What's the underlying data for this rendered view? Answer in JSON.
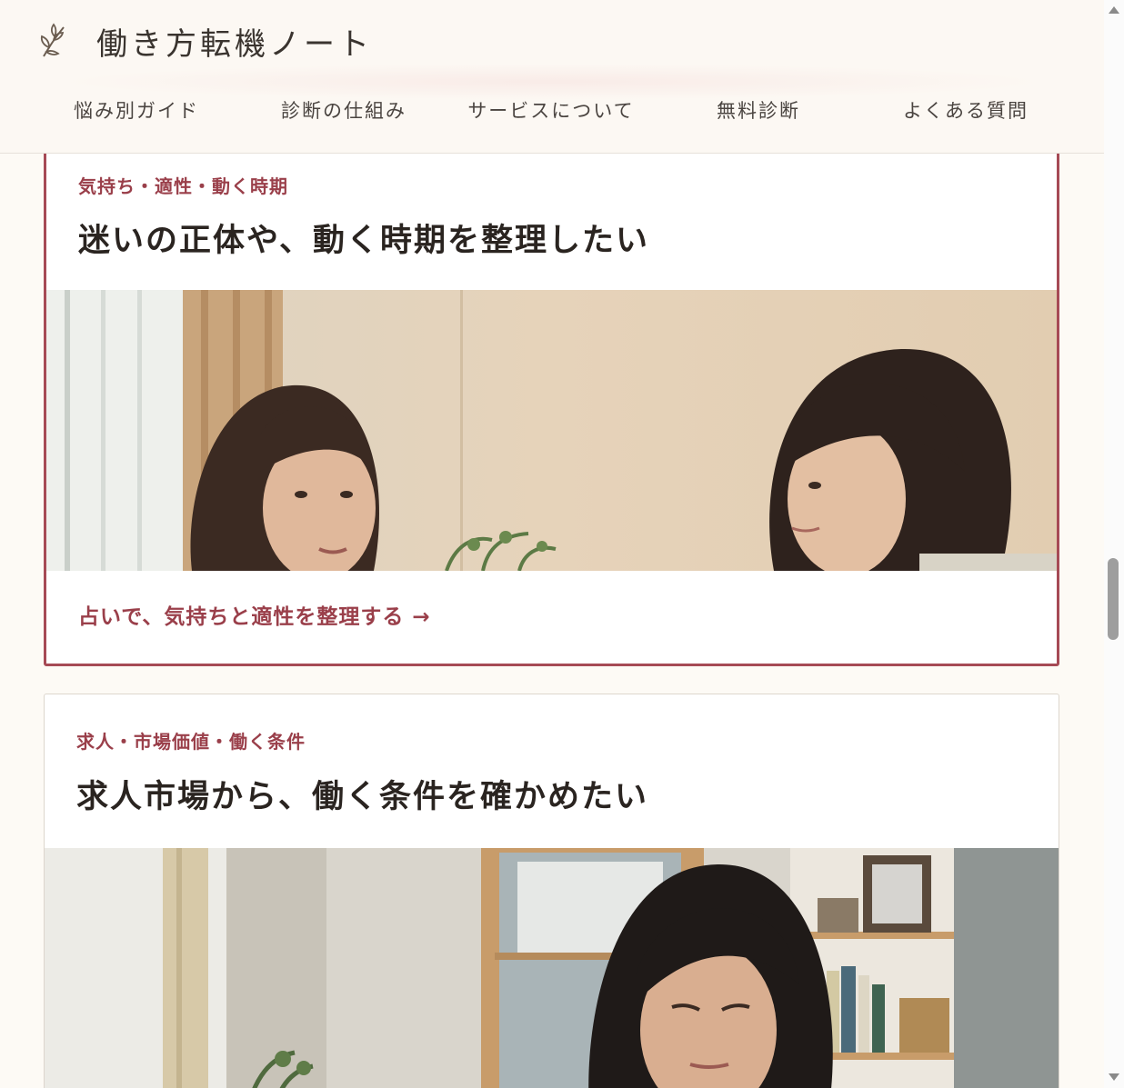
{
  "site": {
    "title": "働き方転機ノート",
    "logo_icon": "sprig-icon"
  },
  "nav": {
    "items": [
      {
        "label": "悩み別ガイド"
      },
      {
        "label": "診断の仕組み"
      },
      {
        "label": "サービスについて"
      },
      {
        "label": "無料診断"
      },
      {
        "label": "よくある質問"
      }
    ]
  },
  "cards": [
    {
      "tag": "気持ち・適性・動く時期",
      "title": "迷いの正体や、動く時期を整理したい",
      "photo": "two-women-talking-photo",
      "link": "占いで、気持ちと適性を整理する →"
    },
    {
      "tag": "求人・市場価値・働く条件",
      "title": "求人市場から、働く条件を確かめたい",
      "photo": "woman-reading-photo"
    }
  ],
  "colors": {
    "accent": "#9a3f4a",
    "border_active": "#a64a55",
    "background": "#fdfaf5"
  }
}
